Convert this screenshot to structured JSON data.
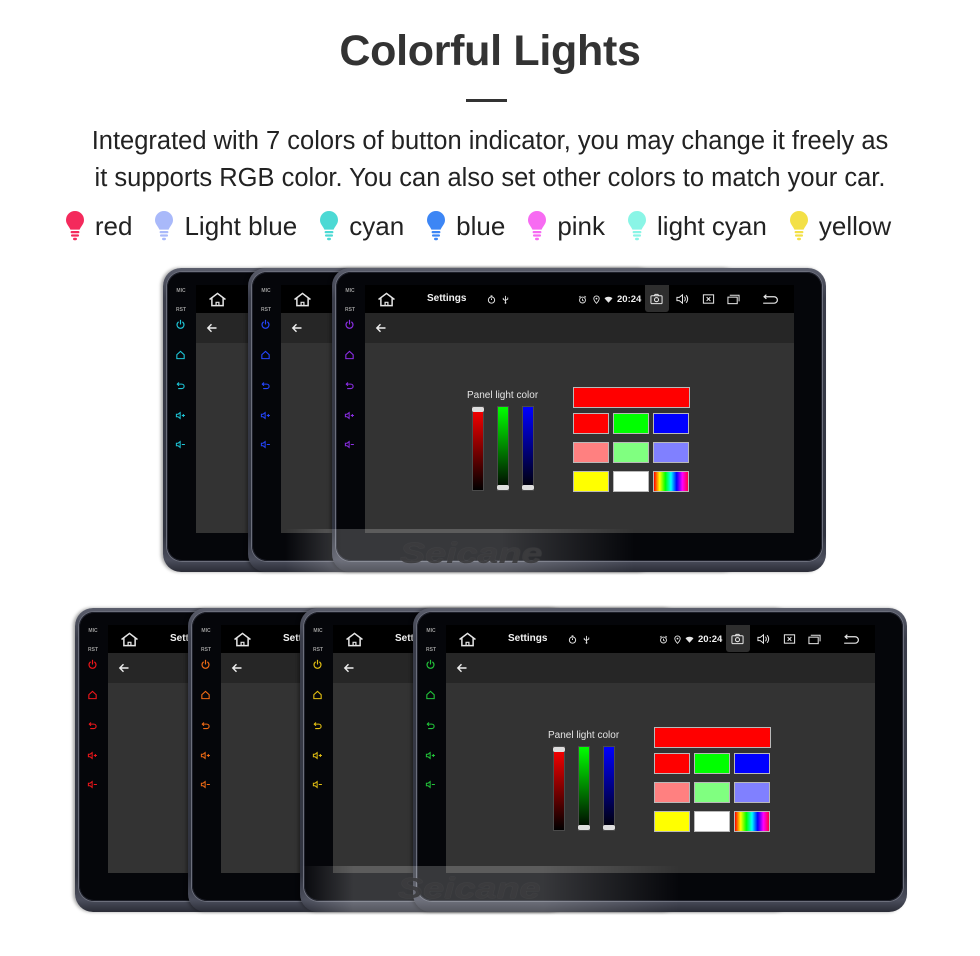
{
  "header": {
    "title": "Colorful Lights",
    "description": [
      "Integrated with 7 colors of button indicator, you may change it freely as",
      "it supports RGB color. You can also set other colors to match your car."
    ]
  },
  "legend": [
    {
      "label": "red",
      "color": "#f42a5c",
      "icon": "bulb-icon"
    },
    {
      "label": "Light blue",
      "color": "#a9b9fa",
      "icon": "bulb-icon"
    },
    {
      "label": "cyan",
      "color": "#4cd9d4",
      "icon": "bulb-icon"
    },
    {
      "label": "blue",
      "color": "#3d86f5",
      "icon": "bulb-icon"
    },
    {
      "label": "pink",
      "color": "#f76bf2",
      "icon": "bulb-icon"
    },
    {
      "label": "light cyan",
      "color": "#8af5e6",
      "icon": "bulb-icon"
    },
    {
      "label": "yellow",
      "color": "#f3e046",
      "icon": "bulb-icon"
    }
  ],
  "device_ui": {
    "mic_label": "MIC",
    "rst_label": "RST",
    "side_buttons": [
      "power-icon",
      "home-icon",
      "back-icon",
      "volume-up-icon",
      "volume-down-icon"
    ],
    "statusbar": {
      "home_icon": "home-icon",
      "title": "Settings",
      "left_icons": [
        "timer-icon",
        "usb-icon"
      ],
      "right_icons": [
        "alarm-icon",
        "location-icon",
        "wifi-icon"
      ],
      "time": "20:24",
      "nav_icons": [
        "screenshot-icon",
        "volume-icon",
        "close-app-icon",
        "recent-apps-icon",
        "return-icon"
      ],
      "active_nav": "screenshot-icon"
    },
    "toolbar": {
      "back_icon": "arrow-back-icon"
    },
    "panel": {
      "label": "Panel light color",
      "sliders": [
        {
          "channel": "red",
          "value": 1.0,
          "color": "#ff0000"
        },
        {
          "channel": "green",
          "value": 0.0,
          "color": "#00ff00"
        },
        {
          "channel": "blue",
          "value": 0.0,
          "color": "#0000ff"
        }
      ],
      "preview_color": "#ff0000",
      "swatches": [
        {
          "name": "red",
          "color": "#ff0000"
        },
        {
          "name": "green",
          "color": "#00ff00"
        },
        {
          "name": "blue",
          "color": "#0000ff"
        },
        {
          "name": "light-red",
          "color": "#ff8080"
        },
        {
          "name": "light-green",
          "color": "#80ff80"
        },
        {
          "name": "light-blue",
          "color": "#8080ff"
        },
        {
          "name": "yellow",
          "color": "#ffff00"
        },
        {
          "name": "white",
          "color": "#ffffff"
        },
        {
          "name": "spectrum",
          "color": "spectrum"
        }
      ]
    }
  },
  "watermark": "Seicane",
  "rows": [
    {
      "position": "top",
      "devices": [
        {
          "indicator_name": "cyan",
          "indicator_color": "#1ec6d8"
        },
        {
          "indicator_name": "blue",
          "indicator_color": "#2446ff"
        },
        {
          "indicator_name": "purple",
          "indicator_color": "#8c2ee6"
        }
      ]
    },
    {
      "position": "bottom",
      "devices": [
        {
          "indicator_name": "red",
          "indicator_color": "#f0161a"
        },
        {
          "indicator_name": "orange",
          "indicator_color": "#f06a14"
        },
        {
          "indicator_name": "yellow",
          "indicator_color": "#e3bf12"
        },
        {
          "indicator_name": "green",
          "indicator_color": "#22c43a"
        }
      ]
    }
  ]
}
